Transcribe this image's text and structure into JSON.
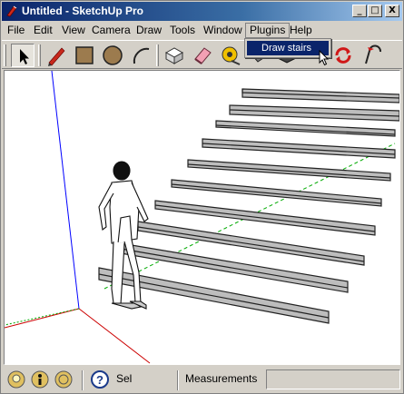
{
  "window": {
    "title": "Untitled - SketchUp Pro",
    "minimize_glyph": "_",
    "maximize_glyph": "□",
    "close_glyph": "X"
  },
  "menubar": {
    "items": [
      {
        "label": "File"
      },
      {
        "label": "Edit"
      },
      {
        "label": "View"
      },
      {
        "label": "Camera"
      },
      {
        "label": "Draw"
      },
      {
        "label": "Tools"
      },
      {
        "label": "Window"
      },
      {
        "label": "Plugins"
      },
      {
        "label": "Help"
      }
    ],
    "active": "Plugins"
  },
  "plugins_menu": {
    "items": [
      {
        "label": "Draw stairs"
      }
    ]
  },
  "toolbar": {
    "tools": [
      "select-icon",
      "pencil-icon",
      "rectangle-icon",
      "circle-icon",
      "arc-icon",
      "eraser-icon",
      "paint-bucket-icon",
      "tape-measure-icon",
      "rotate-icon",
      "follow-me-icon"
    ]
  },
  "statusbar": {
    "sel_label": "Sel",
    "measurements_label": "Measurements",
    "help_glyph": "?"
  },
  "colors": {
    "title_start": "#0a246a",
    "title_end": "#a6caf0",
    "menu_highlight": "#0a246a",
    "step_face": "#bdbdbd",
    "axis_blue": "#0000ff",
    "axis_red": "#cc0000",
    "axis_green": "#00aa00"
  }
}
